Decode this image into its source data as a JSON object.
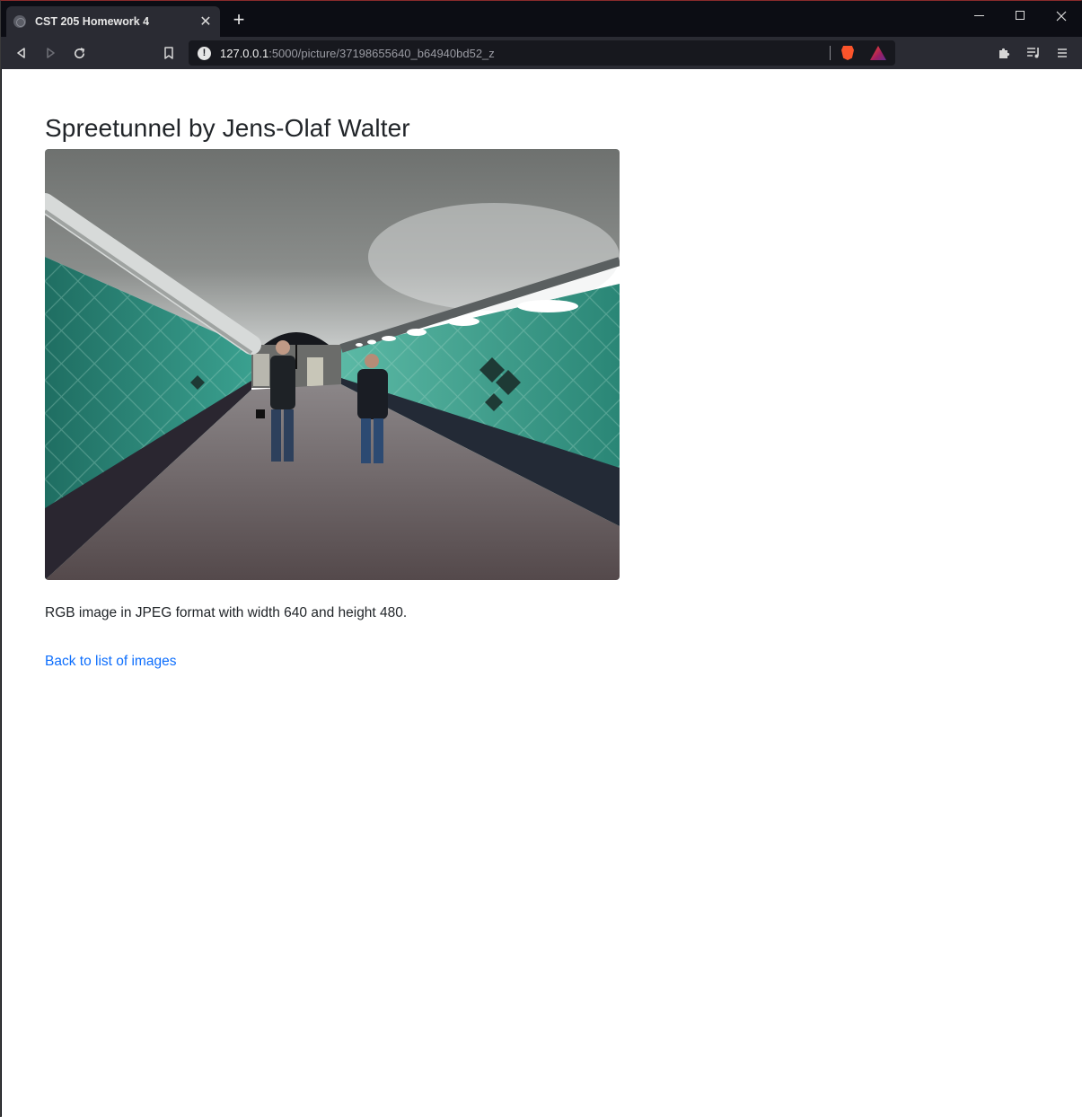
{
  "browser": {
    "tab_title": "CST 205 Homework 4",
    "url_host": "127.0.0.1",
    "url_path": ":5000/picture/37198655640_b64940bd52_z",
    "new_tab_glyph": "+",
    "close_tab_glyph": "✕",
    "icons": {
      "back": "back-icon",
      "forward": "forward-icon",
      "reload": "reload-icon",
      "bookmark": "bookmark-icon",
      "info": "info-icon",
      "extensions": "puzzle-icon",
      "playlist": "playlist-icon",
      "menu": "hamburger-icon"
    }
  },
  "page": {
    "heading": "Spreetunnel by Jens-Olaf Walter",
    "image_description_text": "RGB image in JPEG format with width 640 and height 480.",
    "back_link": "Back to list of images"
  },
  "colors": {
    "link": "#0d6efd",
    "text": "#212529",
    "tile_green": "#2f8f7e"
  }
}
